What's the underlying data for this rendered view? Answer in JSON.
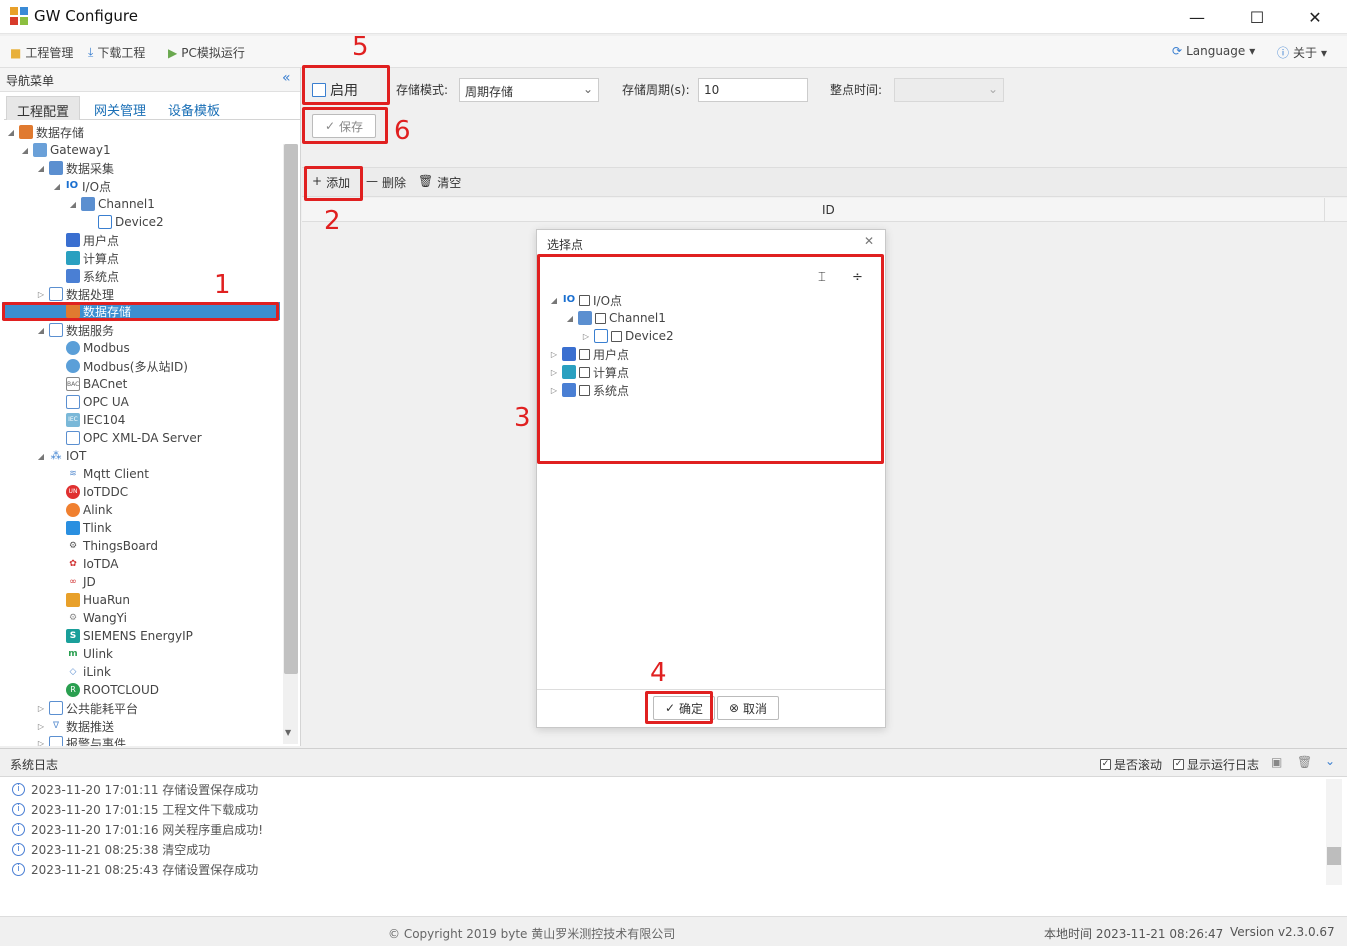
{
  "window": {
    "title": "GW Configure",
    "min": "—",
    "max": "☐",
    "close": "✕"
  },
  "menu": {
    "project": "工程管理",
    "download": "下载工程",
    "pc_run": "PC模拟运行",
    "language": "Language",
    "about": "关于"
  },
  "nav": {
    "header": "导航菜单",
    "collapse": "«",
    "tabs": [
      "工程配置",
      "网关管理",
      "设备模板"
    ],
    "tree": {
      "root": "数据存储",
      "gateway": "Gateway1",
      "acq": "数据采集",
      "io": "I/O点",
      "channel": "Channel1",
      "device": "Device2",
      "user": "用户点",
      "calc": "计算点",
      "sys": "系统点",
      "proc": "数据处理",
      "storage": "数据存储",
      "service": "数据服务",
      "services": [
        "Modbus",
        "Modbus(多从站ID)",
        "BACnet",
        "OPC UA",
        "IEC104",
        "OPC XML-DA Server"
      ],
      "iot": "IOT",
      "iots": [
        "Mqtt Client",
        "IoTDDC",
        "Alink",
        "Tlink",
        "ThingsBoard",
        "IoTDA",
        "JD",
        "HuaRun",
        "WangYi",
        "SIEMENS EnergyIP",
        "Ulink",
        "iLink",
        "ROOTCLOUD"
      ],
      "energy": "公共能耗平台",
      "push": "数据推送",
      "alarm": "报警与事件"
    }
  },
  "form": {
    "enable": "启用",
    "mode_label": "存储模式:",
    "mode_value": "周期存储",
    "period_label": "存储周期(s):",
    "period_value": "10",
    "time_label": "整点时间:",
    "save": "保存"
  },
  "toolbar": {
    "add": "添加",
    "delete": "删除",
    "clear": "清空"
  },
  "table": {
    "col_id": "ID"
  },
  "dialog": {
    "title": "选择点",
    "close": "✕",
    "expand_icon": "⌶",
    "collapse_icon": "÷",
    "items": {
      "io": "I/O点",
      "channel": "Channel1",
      "device": "Device2",
      "user": "用户点",
      "calc": "计算点",
      "sys": "系统点"
    },
    "ok": "确定",
    "cancel": "取消"
  },
  "annotations": [
    "1",
    "2",
    "3",
    "4",
    "5",
    "6"
  ],
  "log": {
    "title": "系统日志",
    "scroll_label": "是否滚动",
    "show_label": "显示运行日志",
    "lines": [
      "2023-11-20 17:01:11 存储设置保存成功",
      "2023-11-20 17:01:15 工程文件下载成功",
      "2023-11-20 17:01:16 网关程序重启成功!",
      "2023-11-21 08:25:38 清空成功",
      "2023-11-21 08:25:43 存储设置保存成功"
    ]
  },
  "status": {
    "copyright": "© Copyright 2019 byte 黄山罗米测控技术有限公司",
    "local_time": "本地时间 2023-11-21 08:26:47",
    "version": "Version v2.3.0.67"
  },
  "colors": {
    "accent": "#1a6fb6",
    "red": "#e02020",
    "selected": "#3c8fd0"
  }
}
